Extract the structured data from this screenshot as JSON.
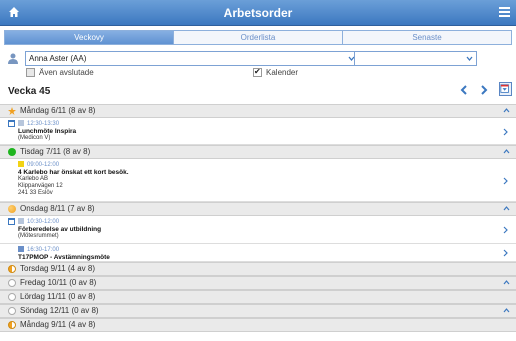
{
  "header": {
    "title": "Arbetsorder"
  },
  "tabs": [
    {
      "label": "Veckovy",
      "active": true
    },
    {
      "label": "Orderlista",
      "active": false
    },
    {
      "label": "Senaste",
      "active": false
    }
  ],
  "filters": {
    "person_value": "Anna Aster (AA)",
    "secondary_value": "",
    "include_done_label": "Även avslutade",
    "include_done_checked": false,
    "calendar_label": "Kalender",
    "calendar_checked": true
  },
  "week_label": "Vecka 45",
  "colors": {
    "accent": "#3c78c0",
    "yellow": "#f2d315",
    "green": "#1fb51f",
    "orange": "#f0a020",
    "blue": "#6a8fc8"
  },
  "days": [
    {
      "label": "Måndag 6/11 (8 av 8)",
      "status_icon": "star-icon",
      "items": [
        {
          "time": "12:30-13:30",
          "title": "Lunchmöte Inspira",
          "lines": [
            "(Medicon V)"
          ]
        }
      ]
    },
    {
      "label": "Tisdag 7/11 (8 av 8)",
      "status_icon": "green-dot",
      "items": [
        {
          "time": "09:00-12:00",
          "title": "4 Karlebo har önskat ett kort besök.",
          "lines": [
            "Karlebo AB",
            "Klippanvägen 12",
            "241 33 Eslöv"
          ]
        }
      ]
    },
    {
      "label": "Onsdag 8/11 (7 av 8)",
      "status_icon": "orange-dot",
      "items": [
        {
          "time": "10:30-12:00",
          "title": "Förberedelse av utbildning",
          "lines": [
            "(Mötesrummet)"
          ]
        },
        {
          "time": "16:30-17:00",
          "title": "T17PMOP - Avstämningsmöte",
          "lines": []
        }
      ]
    },
    {
      "label": "Torsdag 9/11 (4 av 8)",
      "status_icon": "half-dot",
      "items": []
    },
    {
      "label": "Fredag 10/11 (0 av 8)",
      "status_icon": "empty-dot",
      "items": []
    },
    {
      "label": "Lördag 11/11 (0 av 8)",
      "status_icon": "empty-dot",
      "items": []
    },
    {
      "label": "Söndag 12/11 (0 av 8)",
      "status_icon": "empty-dot",
      "items": []
    },
    {
      "label": "Måndag 9/11 (4 av 8)",
      "status_icon": "half-dot",
      "items": []
    }
  ]
}
